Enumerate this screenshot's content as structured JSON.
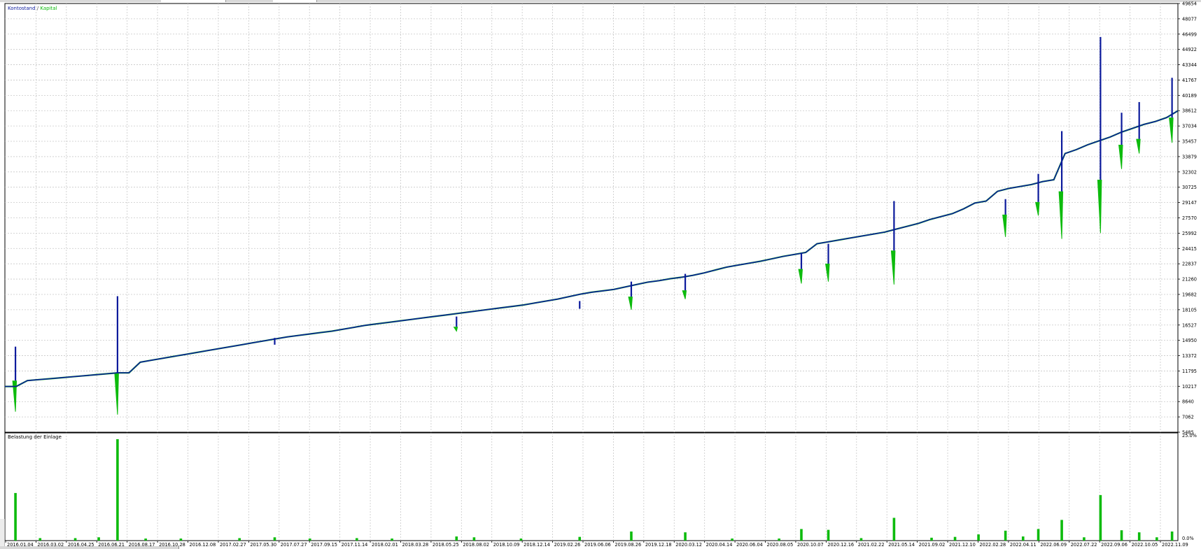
{
  "chart_data": [
    {
      "type": "line",
      "name": "balance-equity",
      "legend": [
        {
          "label": "Kontostand",
          "color": "#0b1a9c"
        },
        {
          "label": " / ",
          "color": "#4a4a4a"
        },
        {
          "label": "Kapital",
          "color": "#0dbb0d"
        }
      ],
      "legend_position": "top-left",
      "y_axis_position": "right",
      "ylim": [
        5485,
        49654
      ],
      "yticks": [
        5485,
        7062,
        8640,
        10217,
        11795,
        13372,
        14950,
        16527,
        18105,
        19682,
        21260,
        22837,
        24415,
        25992,
        27570,
        29147,
        30725,
        32302,
        33879,
        35457,
        37034,
        38612,
        40189,
        41767,
        43344,
        44922,
        46499,
        48077,
        49654
      ],
      "xlim": [
        "2016-01-04",
        "2023-01-02"
      ],
      "xticks": [
        "2016.01.04",
        "2016.03.02",
        "2016.04.25",
        "2016.06.21",
        "2016.08.17",
        "2016.10.28",
        "2016.12.08",
        "2017.02.27",
        "2017.05.30",
        "2017.07.27",
        "2017.09.15",
        "2017.11.14",
        "2018.02.01",
        "2018.03.28",
        "2018.05.25",
        "2018.08.02",
        "2018.10.09",
        "2018.12.14",
        "2019.02.26",
        "2019.06.06",
        "2019.08.26",
        "2019.12.18",
        "2020.03.12",
        "2020.04.14",
        "2020.06.04",
        "2020.08.05",
        "2020.10.07",
        "2020.12.16",
        "2021.02.22",
        "2021.05.14",
        "2021.09.02",
        "2021.12.10",
        "2022.02.28",
        "2022.04.11",
        "2022.06.09",
        "2022.07.22",
        "2022.09.06",
        "2022.10.05",
        "2022.11.09"
      ],
      "grid": true,
      "series": [
        {
          "name": "Kontostand",
          "color": "#0b1a9c",
          "values": [
            10200,
            10200,
            10800,
            10900,
            11000,
            11100,
            11200,
            11300,
            11400,
            11500,
            11600,
            11600,
            12700,
            12900,
            13100,
            13300,
            13500,
            13700,
            13900,
            14100,
            14300,
            14500,
            14700,
            14900,
            15100,
            15300,
            15450,
            15600,
            15750,
            15900,
            16100,
            16300,
            16500,
            16650,
            16800,
            16950,
            17100,
            17250,
            17400,
            17550,
            17700,
            17850,
            18000,
            18150,
            18300,
            18450,
            18600,
            18800,
            19000,
            19200,
            19450,
            19700,
            19900,
            20050,
            20200,
            20450,
            20700,
            20950,
            21100,
            21300,
            21450,
            21650,
            21900,
            22200,
            22500,
            22700,
            22900,
            23100,
            23350,
            23600,
            23800,
            24000,
            24900,
            25100,
            25300,
            25500,
            25700,
            25900,
            26100,
            26400,
            26700,
            27000,
            27400,
            27700,
            28000,
            28500,
            29100,
            29300,
            30300,
            30600,
            30800,
            31000,
            31300,
            31500,
            34200,
            34600,
            35100,
            35500,
            35900,
            36400,
            36800,
            37200,
            37500,
            37900,
            38600
          ]
        },
        {
          "name": "Kapital",
          "color": "#0dbb0d",
          "values": [
            10200,
            10200,
            10800,
            10900,
            11000,
            11100,
            11200,
            11300,
            11400,
            11500,
            11600,
            11600,
            12700,
            12900,
            13100,
            13300,
            13500,
            13700,
            13900,
            14100,
            14300,
            14500,
            14700,
            14900,
            15100,
            15300,
            15450,
            15600,
            15750,
            15900,
            16100,
            16300,
            16500,
            16650,
            16800,
            16950,
            17100,
            17250,
            17400,
            17550,
            17700,
            17850,
            18000,
            18150,
            18300,
            18450,
            18600,
            18800,
            19000,
            19200,
            19450,
            19700,
            19900,
            20050,
            20200,
            20450,
            20700,
            20950,
            21100,
            21300,
            21450,
            21650,
            21900,
            22200,
            22500,
            22700,
            22900,
            23100,
            23350,
            23600,
            23800,
            24000,
            24900,
            25100,
            25300,
            25500,
            25700,
            25900,
            26100,
            26400,
            26700,
            27000,
            27400,
            27700,
            28000,
            28500,
            29100,
            29300,
            30300,
            30600,
            30800,
            31000,
            31300,
            31500,
            34200,
            34600,
            35100,
            35500,
            35900,
            36400,
            36800,
            37200,
            37500,
            37900,
            38600
          ]
        }
      ],
      "balance_spikes": [
        {
          "x": 0.009,
          "base": 10800,
          "top": 14300
        },
        {
          "x": 0.096,
          "base": 11600,
          "top": 19500
        },
        {
          "x": 0.23,
          "base": 14500,
          "top": 15200
        },
        {
          "x": 0.385,
          "base": 16350,
          "top": 17400
        },
        {
          "x": 0.49,
          "base": 18200,
          "top": 19000
        },
        {
          "x": 0.534,
          "base": 19450,
          "top": 21000
        },
        {
          "x": 0.58,
          "base": 20100,
          "top": 21800
        },
        {
          "x": 0.679,
          "base": 22300,
          "top": 23900
        },
        {
          "x": 0.702,
          "base": 22850,
          "top": 24900
        },
        {
          "x": 0.758,
          "base": 24200,
          "top": 29300
        },
        {
          "x": 0.853,
          "base": 27900,
          "top": 29500
        },
        {
          "x": 0.881,
          "base": 29200,
          "top": 32100
        },
        {
          "x": 0.901,
          "base": 30300,
          "top": 36500
        },
        {
          "x": 0.934,
          "base": 31500,
          "top": 46200
        },
        {
          "x": 0.952,
          "base": 35100,
          "top": 38400
        },
        {
          "x": 0.967,
          "base": 35700,
          "top": 39500
        },
        {
          "x": 0.995,
          "base": 37900,
          "top": 42000
        }
      ],
      "equity_dips": [
        {
          "x": 0.009,
          "base": 10800,
          "bottom": 7600
        },
        {
          "x": 0.096,
          "base": 11600,
          "bottom": 7300
        },
        {
          "x": 0.385,
          "base": 16350,
          "bottom": 15900
        },
        {
          "x": 0.534,
          "base": 19450,
          "bottom": 18100
        },
        {
          "x": 0.58,
          "base": 20100,
          "bottom": 19200
        },
        {
          "x": 0.679,
          "base": 22300,
          "bottom": 20800
        },
        {
          "x": 0.702,
          "base": 22850,
          "bottom": 21000
        },
        {
          "x": 0.758,
          "base": 24200,
          "bottom": 20700
        },
        {
          "x": 0.853,
          "base": 27900,
          "bottom": 25600
        },
        {
          "x": 0.881,
          "base": 29200,
          "bottom": 27800
        },
        {
          "x": 0.901,
          "base": 30300,
          "bottom": 25400
        },
        {
          "x": 0.934,
          "base": 31500,
          "bottom": 26000
        },
        {
          "x": 0.952,
          "base": 35100,
          "bottom": 32600
        },
        {
          "x": 0.967,
          "base": 35700,
          "bottom": 34200
        },
        {
          "x": 0.995,
          "base": 37900,
          "bottom": 35300
        }
      ]
    },
    {
      "type": "bar",
      "name": "deposit-load",
      "title": "Belastung der Einlage",
      "y_axis_position": "right",
      "ylim": [
        0,
        25.0
      ],
      "yticks": [
        "0.0%",
        "25.0%"
      ],
      "bar_color": "#0dbb0d",
      "values": [
        {
          "x": 0.009,
          "v": 11.5
        },
        {
          "x": 0.096,
          "v": 24.5
        },
        {
          "x": 0.03,
          "v": 0.6
        },
        {
          "x": 0.06,
          "v": 0.6
        },
        {
          "x": 0.08,
          "v": 0.8
        },
        {
          "x": 0.12,
          "v": 0.5
        },
        {
          "x": 0.15,
          "v": 0.5
        },
        {
          "x": 0.2,
          "v": 0.6
        },
        {
          "x": 0.23,
          "v": 0.8
        },
        {
          "x": 0.26,
          "v": 0.5
        },
        {
          "x": 0.3,
          "v": 0.6
        },
        {
          "x": 0.33,
          "v": 0.5
        },
        {
          "x": 0.385,
          "v": 1.0
        },
        {
          "x": 0.4,
          "v": 0.8
        },
        {
          "x": 0.44,
          "v": 0.5
        },
        {
          "x": 0.49,
          "v": 0.9
        },
        {
          "x": 0.534,
          "v": 2.2
        },
        {
          "x": 0.58,
          "v": 2.0
        },
        {
          "x": 0.62,
          "v": 0.5
        },
        {
          "x": 0.66,
          "v": 0.5
        },
        {
          "x": 0.679,
          "v": 2.8
        },
        {
          "x": 0.702,
          "v": 2.6
        },
        {
          "x": 0.73,
          "v": 0.6
        },
        {
          "x": 0.758,
          "v": 5.5
        },
        {
          "x": 0.79,
          "v": 0.7
        },
        {
          "x": 0.81,
          "v": 0.9
        },
        {
          "x": 0.83,
          "v": 1.5
        },
        {
          "x": 0.853,
          "v": 2.4
        },
        {
          "x": 0.868,
          "v": 1.0
        },
        {
          "x": 0.881,
          "v": 2.8
        },
        {
          "x": 0.901,
          "v": 5.0
        },
        {
          "x": 0.92,
          "v": 0.8
        },
        {
          "x": 0.934,
          "v": 11.0
        },
        {
          "x": 0.952,
          "v": 2.5
        },
        {
          "x": 0.967,
          "v": 2.0
        },
        {
          "x": 0.982,
          "v": 0.8
        },
        {
          "x": 0.995,
          "v": 2.2
        }
      ]
    }
  ]
}
